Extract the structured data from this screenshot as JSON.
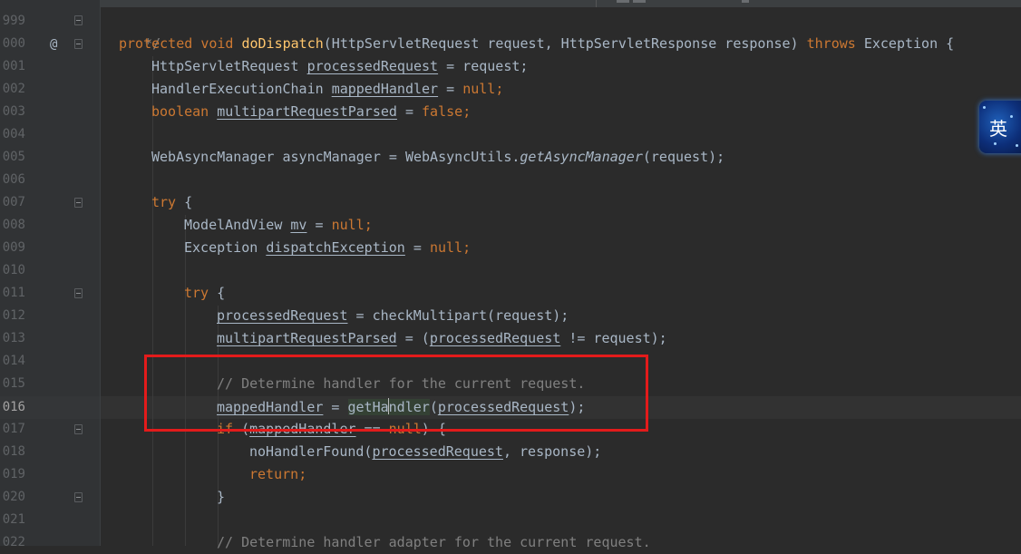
{
  "gutter": {
    "line_numbers": [
      "999",
      "1000",
      "1001",
      "1002",
      "1003",
      "1004",
      "1005",
      "1006",
      "1007",
      "1008",
      "1009",
      "1010",
      "1011",
      "1012",
      "1013",
      "1014",
      "1015",
      "1016",
      "1017",
      "1018",
      "1019",
      "1020",
      "1021",
      "1022"
    ],
    "visible_line_numbers": [
      "999",
      "000",
      "001",
      "002",
      "003",
      "004",
      "005",
      "006",
      "007",
      "008",
      "009",
      "010",
      "011",
      "012",
      "013",
      "014",
      "015",
      "016",
      "017",
      "018",
      "019",
      "020",
      "021",
      "022"
    ],
    "current_line": "1016",
    "override_marker": "@"
  },
  "code": {
    "l999": {
      "comment": "*/"
    },
    "l1000": {
      "protected": "protected",
      "void": "void",
      "method": "doDispatch",
      "p1": "(HttpServletRequest request, HttpServletResponse response) ",
      "throws": "throws",
      "p2": " Exception {"
    },
    "l1001": {
      "type": "HttpServletRequest ",
      "var": "processedRequest",
      "rest": " = request;"
    },
    "l1002": {
      "type": "HandlerExecutionChain ",
      "var": "mappedHandler",
      "eq": " = ",
      "null": "null",
      "semi": ";"
    },
    "l1003": {
      "boolean": "boolean",
      "sp": " ",
      "var": "multipartRequestParsed",
      "eq": " = ",
      "false": "false",
      "semi": ";"
    },
    "l1005": {
      "pre": "WebAsyncManager asyncManager = WebAsyncUtils.",
      "method": "getAsyncManager",
      "post": "(request);"
    },
    "l1007": {
      "try": "try",
      "brace": " {"
    },
    "l1008": {
      "type": "ModelAndView ",
      "var": "mv",
      "eq": " = ",
      "null": "null",
      "semi": ";"
    },
    "l1009": {
      "type": "Exception ",
      "var": "dispatchException",
      "eq": " = ",
      "null": "null",
      "semi": ";"
    },
    "l1011": {
      "try": "try",
      "brace": " {"
    },
    "l1012": {
      "var": "processedRequest",
      "rest": " = checkMultipart(request);"
    },
    "l1013": {
      "var": "multipartRequestParsed",
      "mid": " = (",
      "var2": "processedRequest",
      "rest": " != request);"
    },
    "l1015": {
      "comment": "// Determine handler for the current request."
    },
    "l1016": {
      "var": "mappedHandler",
      "eq": " = ",
      "call_a": "getHa",
      "call_b": "ndler",
      "open": "(",
      "arg": "processedRequest",
      "close": ");"
    },
    "l1017": {
      "if": "if",
      "open": " (",
      "var": "mappedHandler",
      "mid": " == ",
      "null": "null",
      "close": ") {"
    },
    "l1018": {
      "call": "noHandlerFound(",
      "arg": "processedRequest",
      "rest": ", response);"
    },
    "l1019": {
      "return": "return",
      "semi": ";"
    },
    "l1020": {
      "brace": "}"
    },
    "l1022": {
      "comment": "// Determine handler adapter for the current request."
    }
  },
  "ime": {
    "label": "英"
  },
  "colors": {
    "background": "#2b2b2b",
    "keyword": "#cc7832",
    "method_decl": "#ffc66d",
    "comment": "#808080",
    "text": "#a9b7c6",
    "highlight_box": "#e31b1b"
  }
}
